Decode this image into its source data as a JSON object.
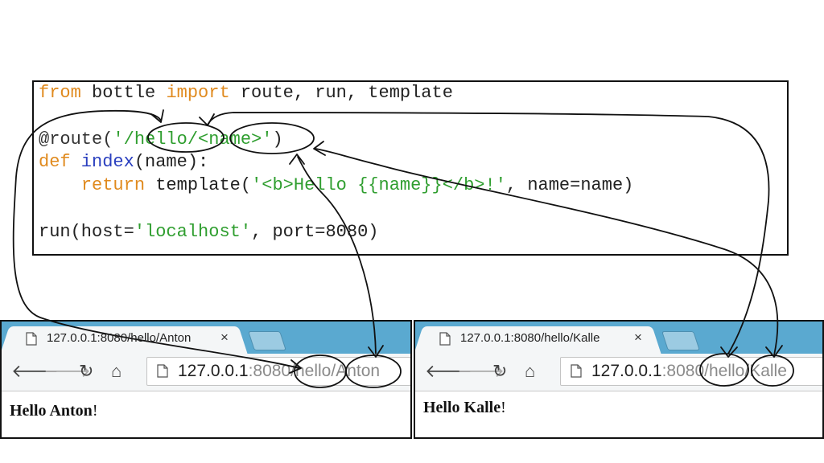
{
  "code": {
    "line1": {
      "kw_from": "from",
      "mod": " bottle ",
      "kw_import": "import",
      "rest": " route, run, template"
    },
    "line2": {
      "dec": "@route(",
      "q1": "'/",
      "hello": "hello",
      "slash": "/",
      "name": "<name>",
      "q2": "'",
      "close": ")"
    },
    "line3": {
      "kw_def": "def",
      "fn": " index",
      "args": "(name):"
    },
    "line4": {
      "indent": "    ",
      "kw_return": "return",
      "call": " template(",
      "str": "'<b>Hello {{name}}</b>!'",
      "rest": ", name=name)"
    },
    "line5": {
      "call": "run(host=",
      "str": "'localhost'",
      "rest": ", port=8080)"
    }
  },
  "browsers": [
    {
      "tab_title": "127.0.0.1:8080/hello/Anton",
      "tab_close": "×",
      "url_host": "127.0.0.1",
      "url_port": ":8080",
      "url_path1": "/hello",
      "url_path2": "/Anton",
      "page_prefix": "Hello ",
      "page_name": "Anton",
      "page_suffix": "!"
    },
    {
      "tab_title": "127.0.0.1:8080/hello/Kalle",
      "tab_close": "×",
      "url_host": "127.0.0.1",
      "url_port": ":8080",
      "url_path1": "/hello",
      "url_path2": "/Kalle",
      "page_prefix": "Hello ",
      "page_name": "Kalle",
      "page_suffix": "!"
    }
  ],
  "icons": {
    "back": "back-arrow-icon",
    "forward": "forward-arrow-icon",
    "reload": "reload-icon",
    "home": "home-icon",
    "page": "page-icon"
  },
  "colors": {
    "keyword": "#e08a1e",
    "function": "#2a3fbf",
    "string": "#2f9e2f",
    "tabstrip": "#5aa9d0"
  }
}
